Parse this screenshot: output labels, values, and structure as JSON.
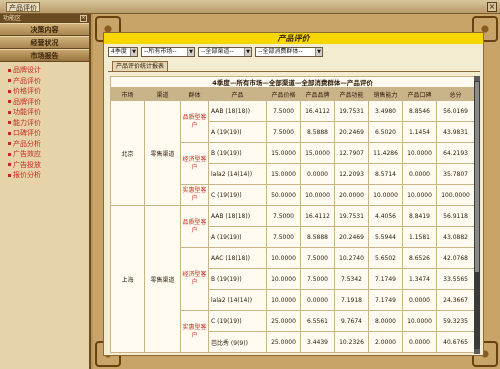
{
  "window": {
    "title": "产品评价",
    "close_label": "×"
  },
  "sidebar": {
    "header": "功能区",
    "sections": [
      {
        "label": "决策内容",
        "active": false
      },
      {
        "label": "经营状况",
        "active": false
      },
      {
        "label": "市场报告",
        "active": true
      }
    ],
    "items": [
      {
        "label": "品牌设计"
      },
      {
        "label": "产品评价"
      },
      {
        "label": "价格评价"
      },
      {
        "label": "品牌评价"
      },
      {
        "label": "功能评价"
      },
      {
        "label": "能力评价"
      },
      {
        "label": "口碑评价"
      },
      {
        "label": "产品分析"
      },
      {
        "label": "广告效应"
      },
      {
        "label": "广告投放"
      },
      {
        "label": "报价分析"
      }
    ]
  },
  "content": {
    "title": "产品评价",
    "filters": [
      {
        "value": "4季度"
      },
      {
        "value": "--所有市场--"
      },
      {
        "value": "--全部渠道--"
      },
      {
        "value": "--全部消费群体--"
      }
    ],
    "tab": "产品评价统计报表",
    "table": {
      "caption": "4季度—所有市场—全部渠道—全部消费群体—产品评价",
      "columns": [
        "市场",
        "渠道",
        "群体",
        "产品",
        "产品价格",
        "产品品牌",
        "产品功能",
        "销售能力",
        "产品口碑",
        "总分"
      ],
      "markets": [
        {
          "market": "北京",
          "channel": "零售渠道",
          "groups": [
            {
              "group": "品质型客户",
              "rows": [
                {
                  "product": "AAB  (18(18))",
                  "price": "7.5000",
                  "brand": "16.4112",
                  "func": "19.7531",
                  "sales": "3.4980",
                  "word": "8.8546",
                  "total": "56.0169"
                },
                {
                  "product": "A  (19(19))",
                  "price": "7.5000",
                  "brand": "8.5888",
                  "func": "20.2469",
                  "sales": "6.5020",
                  "word": "1.1454",
                  "total": "43.9831"
                }
              ]
            },
            {
              "group": "经济型客户",
              "rows": [
                {
                  "product": "B  (19(19))",
                  "price": "15.0000",
                  "brand": "15.0000",
                  "func": "12.7907",
                  "sales": "11.4286",
                  "word": "10.0000",
                  "total": "64.2193"
                },
                {
                  "product": "lala2  (14(14))",
                  "price": "15.0000",
                  "brand": "0.0000",
                  "func": "12.2093",
                  "sales": "8.5714",
                  "word": "0.0000",
                  "total": "35.7807"
                }
              ]
            },
            {
              "group": "实惠型客户",
              "rows": [
                {
                  "product": "C  (19(19))",
                  "price": "50.0000",
                  "brand": "10.0000",
                  "func": "20.0000",
                  "sales": "10.0000",
                  "word": "10.0000",
                  "total": "100.0000"
                }
              ]
            }
          ]
        },
        {
          "market": "上海",
          "channel": "零售渠道",
          "groups": [
            {
              "group": "品质型客户",
              "rows": [
                {
                  "product": "AAB  (18(18))",
                  "price": "7.5000",
                  "brand": "16.4112",
                  "func": "19.7531",
                  "sales": "4.4056",
                  "word": "8.8419",
                  "total": "56.9118"
                },
                {
                  "product": "A  (19(19))",
                  "price": "7.5000",
                  "brand": "8.5888",
                  "func": "20.2469",
                  "sales": "5.5944",
                  "word": "1.1581",
                  "total": "43.0882"
                }
              ]
            },
            {
              "group": "经济型客户",
              "rows": [
                {
                  "product": "AAC  (18(18))",
                  "price": "10.0000",
                  "brand": "7.5000",
                  "func": "10.2740",
                  "sales": "5.6502",
                  "word": "8.6526",
                  "total": "42.0768"
                },
                {
                  "product": "B  (19(19))",
                  "price": "10.0000",
                  "brand": "7.5000",
                  "func": "7.5342",
                  "sales": "7.1749",
                  "word": "1.3474",
                  "total": "33.5565"
                },
                {
                  "product": "lala2  (14(14))",
                  "price": "10.0000",
                  "brand": "0.0000",
                  "func": "7.1918",
                  "sales": "7.1749",
                  "word": "0.0000",
                  "total": "24.3667"
                }
              ]
            },
            {
              "group": "实惠型客户",
              "rows": [
                {
                  "product": "C  (19(19))",
                  "price": "25.0000",
                  "brand": "6.5561",
                  "func": "9.7674",
                  "sales": "8.0000",
                  "word": "10.0000",
                  "total": "59.3235"
                },
                {
                  "product": "芭比秀  (9(9))",
                  "price": "25.0000",
                  "brand": "3.4439",
                  "func": "10.2326",
                  "sales": "2.0000",
                  "word": "0.0000",
                  "total": "40.6765"
                }
              ]
            }
          ]
        }
      ]
    }
  }
}
